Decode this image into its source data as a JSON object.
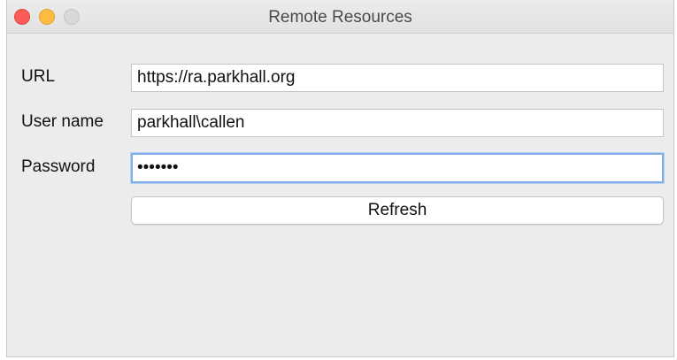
{
  "window": {
    "title": "Remote Resources"
  },
  "form": {
    "url": {
      "label": "URL",
      "value": "https://ra.parkhall.org"
    },
    "username": {
      "label": "User name",
      "value": "parkhall\\callen"
    },
    "password": {
      "label": "Password",
      "value": "•••••••"
    },
    "refresh_label": "Refresh"
  },
  "colors": {
    "close": "#fc5c57",
    "minimize": "#fdbc40",
    "zoom": "#d9d9d9",
    "focus_ring": "#7eaee8"
  }
}
